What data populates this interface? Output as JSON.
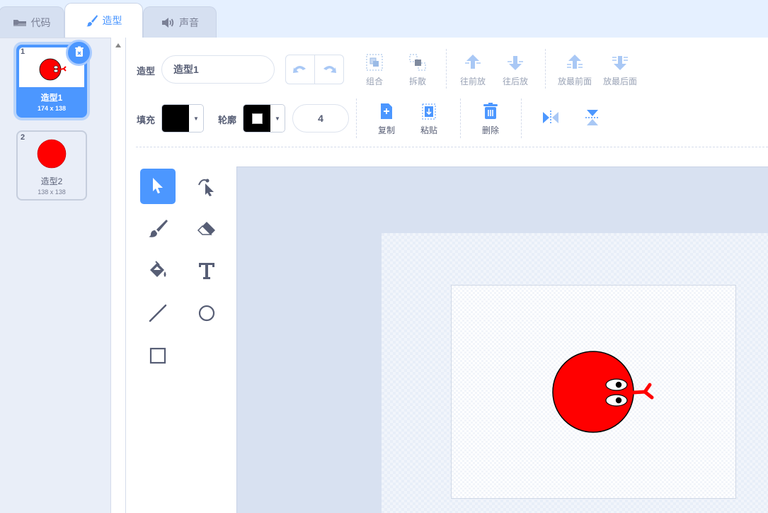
{
  "tabs": [
    {
      "label": "代码",
      "icon": "code-icon"
    },
    {
      "label": "造型",
      "icon": "brush-icon",
      "active": true
    },
    {
      "label": "声音",
      "icon": "speaker-icon"
    }
  ],
  "costumes": [
    {
      "index": "1",
      "name": "造型1",
      "size": "174 x 138",
      "selected": true
    },
    {
      "index": "2",
      "name": "造型2",
      "size": "138 x 138",
      "selected": false
    }
  ],
  "toolbar": {
    "costume_label": "造型",
    "costume_name": "造型1",
    "group": "组合",
    "ungroup": "拆散",
    "forward": "往前放",
    "backward": "往后放",
    "front": "放最前面",
    "back": "放最后面",
    "fill_label": "填充",
    "outline_label": "轮廓",
    "outline_width": "4",
    "copy": "复制",
    "paste": "粘贴",
    "delete": "删除"
  },
  "colors": {
    "accent": "#4c97ff",
    "fill": "#000000",
    "outline": "#000000",
    "sprite": "#ff0000"
  },
  "tools": [
    "select-tool",
    "reshape-tool",
    "brush-tool",
    "eraser-tool",
    "fill-tool",
    "text-tool",
    "line-tool",
    "circle-tool",
    "rectangle-tool"
  ]
}
